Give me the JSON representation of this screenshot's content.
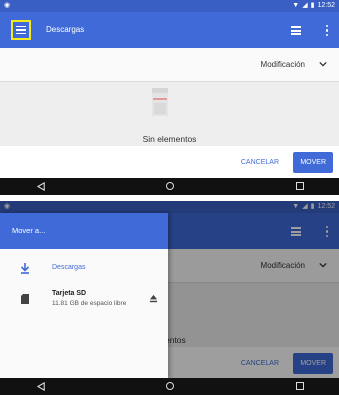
{
  "top_screen": {
    "status_bar": {
      "time": "12:52"
    },
    "app_bar": {
      "title": "Descargas"
    },
    "sort_bar": {
      "label": "Modificación"
    },
    "empty_state": {
      "text": "Sin elementos"
    },
    "actions": {
      "cancel_label": "CANCELAR",
      "move_label": "MOVER"
    }
  },
  "bottom_screen": {
    "status_bar": {
      "time": "12:52"
    },
    "drawer": {
      "header_title": "Mover a...",
      "items": [
        {
          "label": "Descargas",
          "icon": "download-icon"
        },
        {
          "label": "Tarjeta SD",
          "subtitle": "11.81 GB de espacio libre",
          "icon": "sd-card-icon",
          "action_icon": "eject-icon"
        }
      ]
    },
    "background_labels": {
      "sort_label": "Modificación",
      "empty_text_partial": "ementos",
      "cancel_label": "CANCELAR",
      "move_label": "MOVER"
    }
  },
  "colors": {
    "primary": "#3f6ad8",
    "status_bar": "#3a5fc4",
    "highlight": "#f2ea1e",
    "nav_bar": "#111111"
  }
}
